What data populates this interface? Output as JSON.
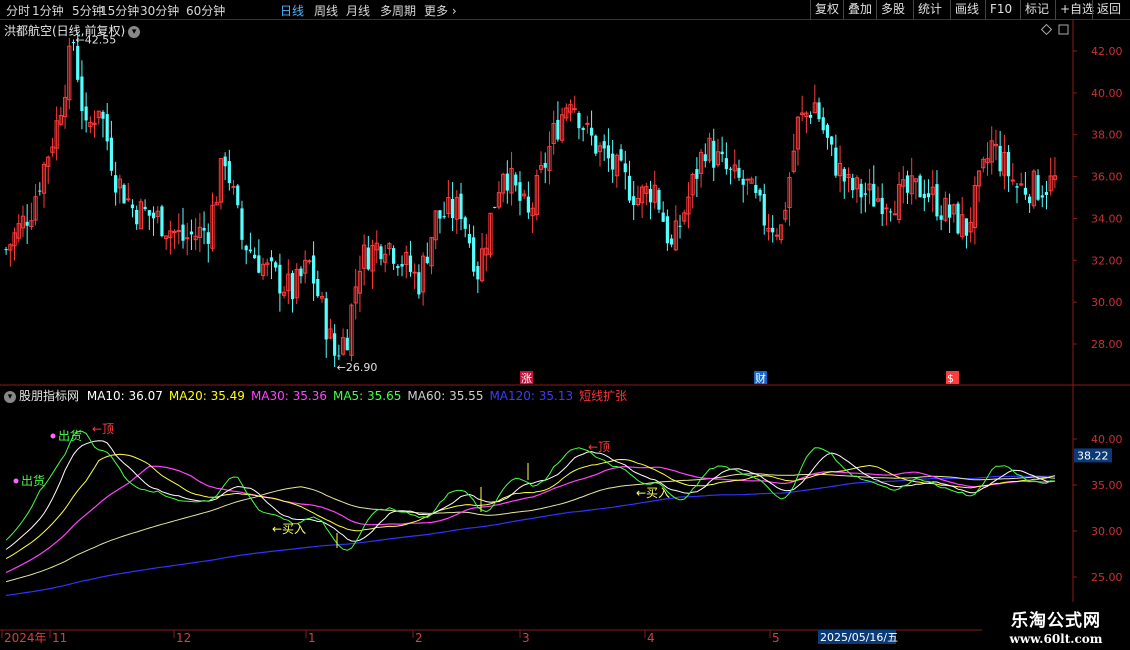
{
  "toolbar": {
    "periods": [
      "分时",
      "1分钟",
      "5分钟",
      "15分钟",
      "30分钟",
      "60分钟",
      "日线",
      "周线",
      "月线",
      "多周期",
      "更多"
    ],
    "active_period": "日线",
    "more_arrow": "›",
    "right_buttons": [
      "复权",
      "叠加",
      "多股",
      "统计",
      "画线",
      "F10",
      "标记",
      "+自选",
      "返回"
    ]
  },
  "main_panel": {
    "title": "洪都航空(日线,前复权)",
    "dropdown_icon": "chevron-down-icon",
    "corner_icons": [
      "diamond-icon",
      "square-icon"
    ],
    "high_label": "42.55",
    "low_label": "26.90",
    "y_ticks": [
      "42.00",
      "40.00",
      "38.00",
      "36.00",
      "34.00",
      "32.00",
      "30.00",
      "28.00"
    ],
    "markers": [
      {
        "label": "涨",
        "color": "#c0143c"
      },
      {
        "label": "财",
        "color": "#1464c8"
      },
      {
        "label": "$",
        "color": "#ff3c3c"
      }
    ]
  },
  "indicator_panel": {
    "name": "股朋指标网",
    "legend": [
      {
        "text": "MA10: 36.07",
        "color": "#ffffff"
      },
      {
        "text": "MA20: 35.49",
        "color": "#ffff00"
      },
      {
        "text": "MA30: 35.36",
        "color": "#ff44ff"
      },
      {
        "text": "MA5: 35.65",
        "color": "#44ff44"
      },
      {
        "text": "MA60: 35.55",
        "color": "#cfcfcf"
      },
      {
        "text": "MA120: 35.13",
        "color": "#3c3cff"
      },
      {
        "text": "短线扩张",
        "color": "#ff3333"
      }
    ],
    "y_ticks": [
      "40.00",
      "35.00",
      "30.00",
      "25.00"
    ],
    "current_value": "38.22",
    "signals": {
      "top": "←顶",
      "buy": "←买入",
      "sell": "出货",
      "sell2": "出货"
    }
  },
  "time_axis": {
    "labels": [
      "2024年",
      "11",
      "12",
      "1",
      "2",
      "3",
      "4",
      "5"
    ],
    "cursor_date": "2025/05/16/五"
  },
  "watermark": {
    "line1": "乐淘公式网",
    "line2": "www.60lt.com"
  }
}
